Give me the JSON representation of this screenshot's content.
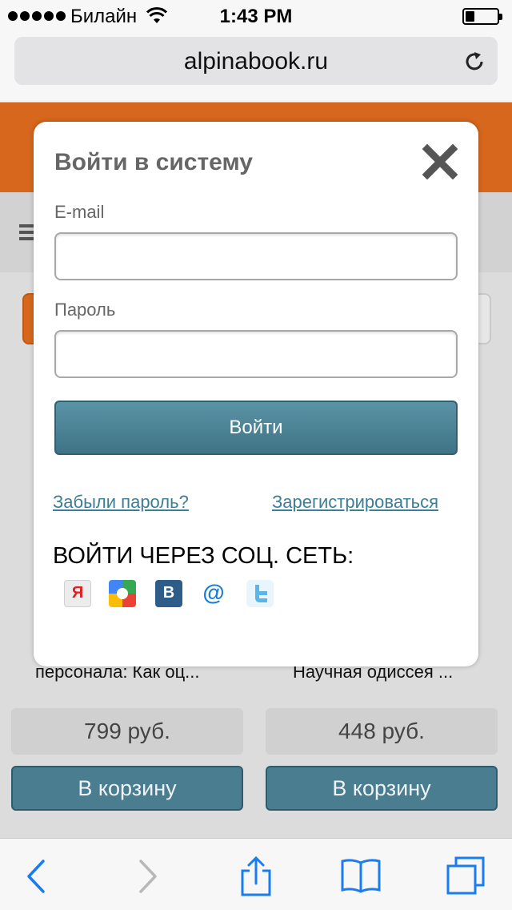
{
  "status_bar": {
    "carrier": "Билайн",
    "time": "1:43 PM",
    "battery_level": 0.3
  },
  "browser": {
    "url": "alpinabook.ru"
  },
  "books": [
    {
      "title": "персонала: Как оц...",
      "price": "799 руб.",
      "cart_label": "В корзину"
    },
    {
      "title": "Научная одиссея ...",
      "price": "448 руб.",
      "cart_label": "В корзину"
    }
  ],
  "login_modal": {
    "title": "Войти в систему",
    "email_label": "E-mail",
    "email_value": "",
    "password_label": "Пароль",
    "password_value": "",
    "submit_label": "Войти",
    "forgot_link": "Забыли пароль?",
    "register_link": "Зарегистрироваться",
    "social_title": "ВОЙТИ ЧЕРЕЗ СОЦ. СЕТЬ:",
    "social_networks": [
      {
        "name": "yandex",
        "glyph": "Я",
        "color": "#e8e8e8"
      },
      {
        "name": "google",
        "glyph": "",
        "color": "#4285f4"
      },
      {
        "name": "vkontakte",
        "glyph": "B",
        "color": "#2f5d8a"
      },
      {
        "name": "mail-ru",
        "glyph": "@",
        "color": "#ffffff"
      },
      {
        "name": "twitter",
        "glyph": "",
        "color": "#5ab5e8"
      }
    ]
  },
  "colors": {
    "brand_orange": "#d6671d",
    "button_teal": "#4a7d8f",
    "link_blue": "#3b7f96",
    "ios_blue": "#1a7cf3"
  }
}
